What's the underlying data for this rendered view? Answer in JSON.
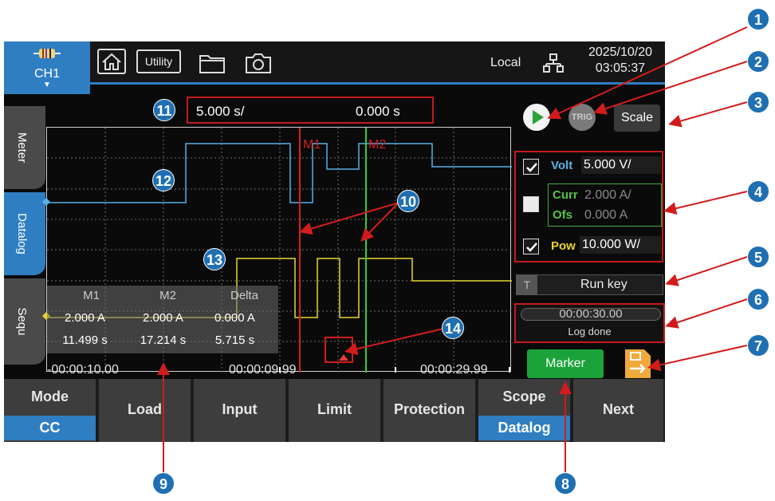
{
  "top_bar": {
    "channel": "CH1",
    "utility_label": "Utility",
    "remote_status": "Local",
    "date": "2025/10/20",
    "time": "03:05:37",
    "icons": [
      "resistor-icon",
      "home-icon",
      "folder-icon",
      "camera-icon",
      "network-icon"
    ]
  },
  "side_tabs": [
    "Meter",
    "Datalog",
    "Sequ"
  ],
  "active_side_tab": "Datalog",
  "timebase": {
    "per_div": "5.000 s/",
    "offset": "0.000 s"
  },
  "markers": {
    "m1": "M1",
    "m2": "M2"
  },
  "measurements": {
    "headers": [
      "M1",
      "M2",
      "Delta"
    ],
    "current": [
      "2.000 A",
      "2.000 A",
      "0.000 A"
    ],
    "time": [
      "11.499 s",
      "17.214 s",
      "5.715 s"
    ]
  },
  "x_axis": {
    "left": "-00:00:10.00",
    "center": "00:00:09.99",
    "right": "00:00:29.99"
  },
  "channels": [
    {
      "name": "Volt",
      "enabled": true,
      "value": "5.000 V/",
      "color": "#5ab0e6"
    },
    {
      "name": "Curr",
      "name2": "Ofs",
      "enabled": false,
      "value": "2.000 A/",
      "offset": "0.000 A",
      "color": "#59c24d"
    },
    {
      "name": "Pow",
      "enabled": true,
      "value": "10.000 W/",
      "color": "#e8d431"
    }
  ],
  "trigger": {
    "t_label": "T",
    "source": "Run key"
  },
  "log": {
    "elapsed": "00:00:30.00",
    "status": "Log done"
  },
  "buttons": {
    "run": "run",
    "trig": "TRIG",
    "scale": "Scale",
    "marker": "Marker"
  },
  "softkeys": [
    {
      "label": "Mode",
      "selected": "CC"
    },
    {
      "label": "Load"
    },
    {
      "label": "Input"
    },
    {
      "label": "Limit"
    },
    {
      "label": "Protection"
    },
    {
      "label": "Scope",
      "selected": "Datalog"
    },
    {
      "label": "Next"
    }
  ],
  "callouts": [
    "1",
    "2",
    "3",
    "4",
    "5",
    "6",
    "7",
    "8",
    "9",
    "10",
    "11",
    "12",
    "13",
    "14"
  ],
  "colors": {
    "accent": "#2f7ec2",
    "highlight": "#c41a1a",
    "marker": "#1aa33a",
    "export": "#f0a93b"
  }
}
